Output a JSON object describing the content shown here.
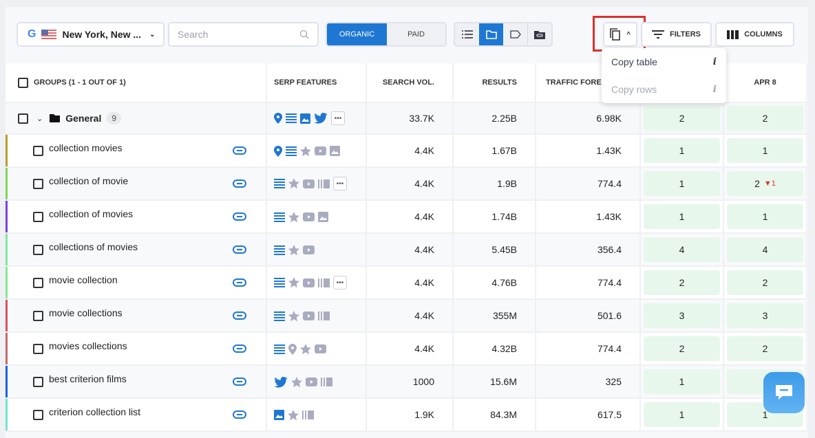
{
  "toolbar": {
    "location": "New York, New ...",
    "search_placeholder": "Search",
    "organic_label": "ORGANIC",
    "paid_label": "PAID",
    "filters_label": "FILTERS",
    "columns_label": "COLUMNS",
    "view_modes": [
      "list-icon",
      "folder-icon",
      "tag-icon",
      "linked-folder-icon"
    ],
    "active_view": "folder-icon"
  },
  "copy_menu": {
    "items": [
      {
        "label": "Copy table",
        "info": "i",
        "enabled": true
      },
      {
        "label": "Copy rows",
        "info": "i",
        "enabled": false
      }
    ]
  },
  "table": {
    "headers": {
      "groups": "GROUPS (1 - 1 OUT OF 1)",
      "serp": "SERP FEATURES",
      "volume": "SEARCH VOL.",
      "results": "RESULTS",
      "traffic": "TRAFFIC FOREC",
      "date2": "APR 8"
    },
    "group": {
      "name": "General",
      "count": "9",
      "serp": [
        "pin",
        "list",
        "image",
        "twitter",
        "more"
      ],
      "volume": "33.7K",
      "results": "2.25B",
      "traffic": "6.98K",
      "pos1": "2",
      "pos2": "2"
    },
    "rows": [
      {
        "keyword": "collection movies",
        "color": "#b3a024",
        "serp": [
          "pin",
          "list",
          "star-g",
          "video-g",
          "image-g"
        ],
        "volume": "4.4K",
        "results": "1.67B",
        "traffic": "1.43K",
        "pos1": "1",
        "pos2": "1",
        "delta": ""
      },
      {
        "keyword": "collection of movie",
        "color": "#7ed957",
        "serp": [
          "list",
          "star-g",
          "video-g",
          "carousel-g",
          "more"
        ],
        "volume": "4.4K",
        "results": "1.9B",
        "traffic": "774.4",
        "pos1": "1",
        "pos2": "2",
        "delta": "1"
      },
      {
        "keyword": "collection of movies",
        "color": "#7b3fe4",
        "serp": [
          "list",
          "star-g",
          "video-g",
          "image-g"
        ],
        "volume": "4.4K",
        "results": "1.74B",
        "traffic": "1.43K",
        "pos1": "1",
        "pos2": "1",
        "delta": ""
      },
      {
        "keyword": "collections of movies",
        "color": "#80e8a2",
        "serp": [
          "list",
          "star-g",
          "video-g"
        ],
        "volume": "4.4K",
        "results": "5.45B",
        "traffic": "356.4",
        "pos1": "4",
        "pos2": "4",
        "delta": ""
      },
      {
        "keyword": "movie collection",
        "color": "#86e88e",
        "serp": [
          "list",
          "star-g",
          "video-g",
          "carousel-g",
          "more"
        ],
        "volume": "4.4K",
        "results": "4.76B",
        "traffic": "774.4",
        "pos1": "2",
        "pos2": "2",
        "delta": ""
      },
      {
        "keyword": "movie collections",
        "color": "#d9505a",
        "serp": [
          "list",
          "star-g",
          "video-g",
          "carousel-g"
        ],
        "volume": "4.4K",
        "results": "355M",
        "traffic": "501.6",
        "pos1": "3",
        "pos2": "3",
        "delta": ""
      },
      {
        "keyword": "movies collections",
        "color": "#c46a6a",
        "serp": [
          "list",
          "pin-g",
          "star-g",
          "video-g"
        ],
        "volume": "4.4K",
        "results": "4.32B",
        "traffic": "774.4",
        "pos1": "2",
        "pos2": "2",
        "delta": ""
      },
      {
        "keyword": "best criterion films",
        "color": "#1b5fe0",
        "serp": [
          "twitter",
          "star-g",
          "video-g",
          "carousel-g"
        ],
        "volume": "1000",
        "results": "15.6M",
        "traffic": "325",
        "pos1": "1",
        "pos2": "",
        "delta": ""
      },
      {
        "keyword": "criterion collection list",
        "color": "#6ee6c8",
        "serp": [
          "image",
          "star-g",
          "carousel-g"
        ],
        "volume": "1.9K",
        "results": "84.3M",
        "traffic": "617.5",
        "pos1": "1",
        "pos2": "1",
        "delta": ""
      }
    ]
  },
  "colors": {
    "accent": "#1e77d3",
    "highlight": "#d9322b",
    "position_bg": "#e7f7ec"
  }
}
